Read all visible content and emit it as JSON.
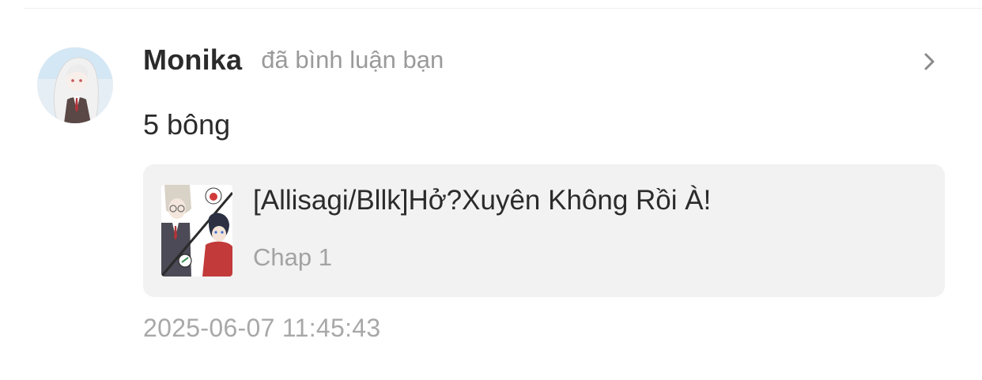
{
  "notification": {
    "username": "Monika",
    "action": "đã bình luận bạn",
    "comment": "5 bông",
    "story": {
      "title": "[Allisagi/Bllk]Hở?Xuyên Không Rồi À!",
      "chapter": "Chap 1"
    },
    "timestamp": "2025-06-07 11:45:43"
  },
  "icons": {
    "avatar": "user-avatar",
    "chevron": "chevron-right-icon",
    "cover": "story-cover-thumbnail"
  },
  "colors": {
    "username": "#2b2b2b",
    "secondary_text": "#9a9a9a",
    "card_background": "#f2f2f2",
    "chevron": "#8a8a8a"
  }
}
